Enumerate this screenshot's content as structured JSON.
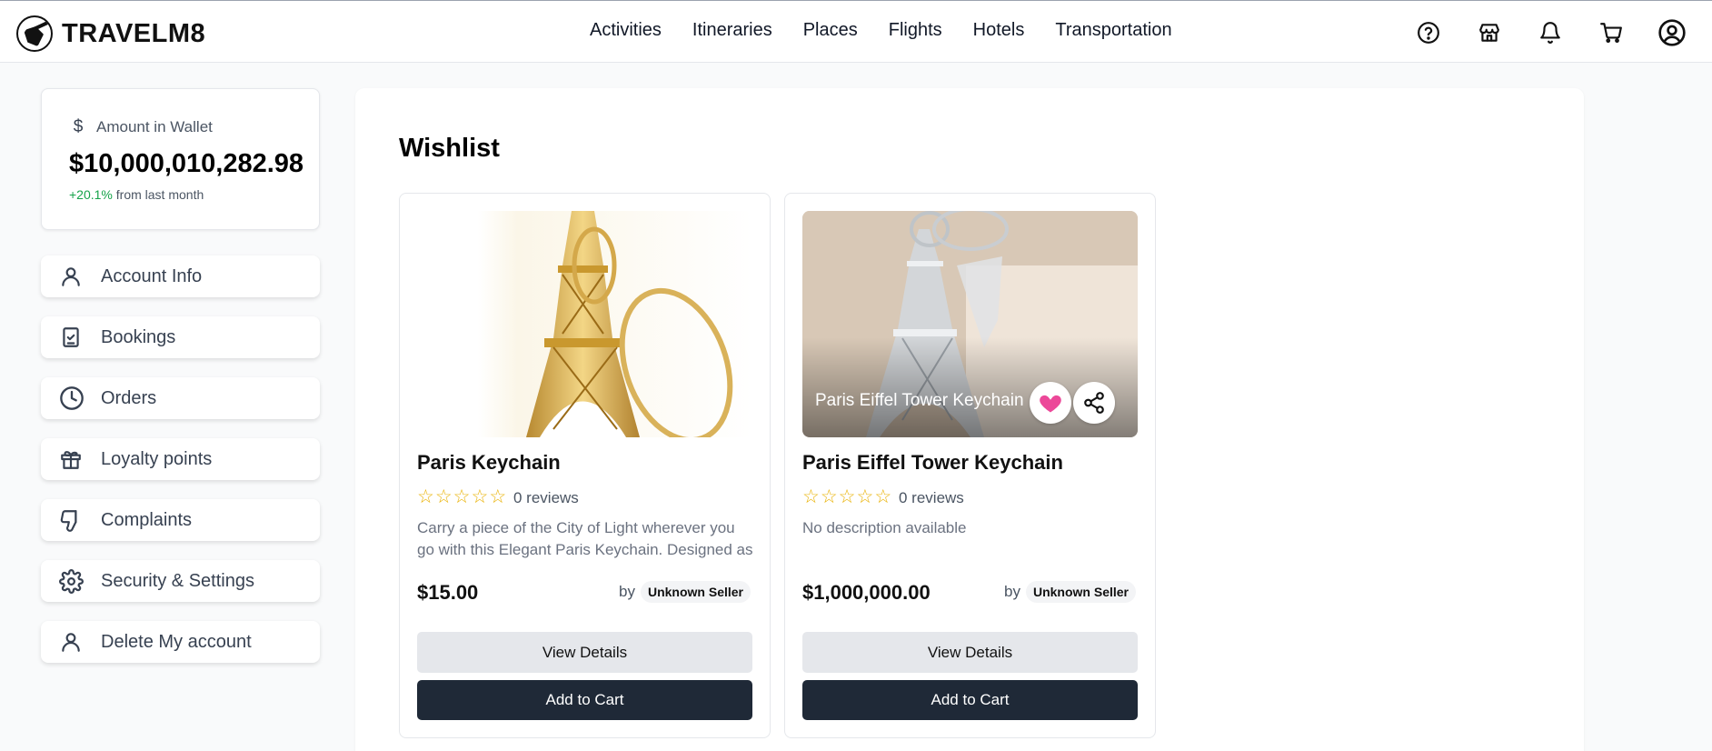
{
  "app": {
    "brand": "TRAVELM8"
  },
  "nav": {
    "activities": "Activities",
    "itineraries": "Itineraries",
    "places": "Places",
    "flights": "Flights",
    "hotels": "Hotels",
    "transportation": "Transportation"
  },
  "header_icons": [
    "help-icon",
    "store-icon",
    "bell-icon",
    "cart-icon",
    "user-circle-icon"
  ],
  "wallet": {
    "label": "Amount in Wallet",
    "amount": "$10,000,010,282.98",
    "change_pct": "+20.1%",
    "change_text": "from last month"
  },
  "sidebar": {
    "items": [
      {
        "label": "Account Info",
        "icon": "user-icon"
      },
      {
        "label": "Bookings",
        "icon": "clipboard-check-icon"
      },
      {
        "label": "Orders",
        "icon": "clock-icon"
      },
      {
        "label": "Loyalty points",
        "icon": "gift-icon"
      },
      {
        "label": "Complaints",
        "icon": "thumbs-down-icon"
      },
      {
        "label": "Security & Settings",
        "icon": "gear-icon"
      },
      {
        "label": "Delete My account",
        "icon": "user-icon"
      }
    ]
  },
  "page": {
    "title": "Wishlist"
  },
  "products": [
    {
      "title": "Paris Keychain",
      "reviews": "0 reviews",
      "description": "Carry a piece of the City of Light wherever you go with this Elegant Paris Keychain. Designed as a miniature Eiffel Tower, this keychain is crafted with care.",
      "price": "$15.00",
      "by": "by",
      "seller": "Unknown Seller",
      "view_label": "View Details",
      "cart_label": "Add to Cart"
    },
    {
      "title": "Paris Eiffel Tower Keychain",
      "image_caption": "Paris Eiffel Tower Keychain",
      "reviews": "0 reviews",
      "description": "No description available",
      "price": "$1,000,000.00",
      "by": "by",
      "seller": "Unknown Seller",
      "view_label": "View Details",
      "cart_label": "Add to Cart"
    }
  ],
  "colors": {
    "accent_dark": "#1f2937",
    "heart": "#ec4899",
    "positive": "#16a34a",
    "star": "#eab308"
  }
}
